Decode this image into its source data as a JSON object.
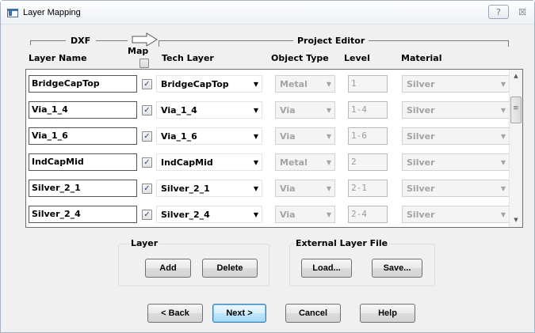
{
  "window": {
    "title": "Layer Mapping",
    "help_glyph": "?",
    "close_glyph": "☒"
  },
  "header": {
    "dxf_label": "DXF",
    "map_label": "Map",
    "project_editor_label": "Project Editor",
    "columns": {
      "layer_name": "Layer Name",
      "tech_layer": "Tech Layer",
      "object_type": "Object Type",
      "level": "Level",
      "material": "Material"
    }
  },
  "rows": [
    {
      "layer_name": "BridgeCapTop",
      "mapped": true,
      "tech_layer": "BridgeCapTop",
      "object_type": "Metal",
      "level": "1",
      "material": "Silver"
    },
    {
      "layer_name": "Via_1_4",
      "mapped": true,
      "tech_layer": "Via_1_4",
      "object_type": "Via",
      "level": "1-4",
      "material": "Silver"
    },
    {
      "layer_name": "Via_1_6",
      "mapped": true,
      "tech_layer": "Via_1_6",
      "object_type": "Via",
      "level": "1-6",
      "material": "Silver"
    },
    {
      "layer_name": "IndCapMid",
      "mapped": true,
      "tech_layer": "IndCapMid",
      "object_type": "Metal",
      "level": "2",
      "material": "Silver"
    },
    {
      "layer_name": "Silver_2_1",
      "mapped": true,
      "tech_layer": "Silver_2_1",
      "object_type": "Via",
      "level": "2-1",
      "material": "Silver"
    },
    {
      "layer_name": "Silver_2_4",
      "mapped": true,
      "tech_layer": "Silver_2_4",
      "object_type": "Via",
      "level": "2-4",
      "material": "Silver"
    }
  ],
  "layer_group": {
    "label": "Layer",
    "add_label": "Add",
    "delete_label": "Delete"
  },
  "external_group": {
    "label": "External Layer File",
    "load_label": "Load...",
    "save_label": "Save..."
  },
  "footer": {
    "back_label": "< Back",
    "next_label": "Next >",
    "cancel_label": "Cancel",
    "help_label": "Help"
  },
  "icons": {
    "check": "✓",
    "dropdown": "▼",
    "scroll_up": "▲",
    "scroll_down": "▼"
  },
  "colors": {
    "default_button_border": "#3c7fb1",
    "checkbox_check": "#2a4b8d"
  }
}
